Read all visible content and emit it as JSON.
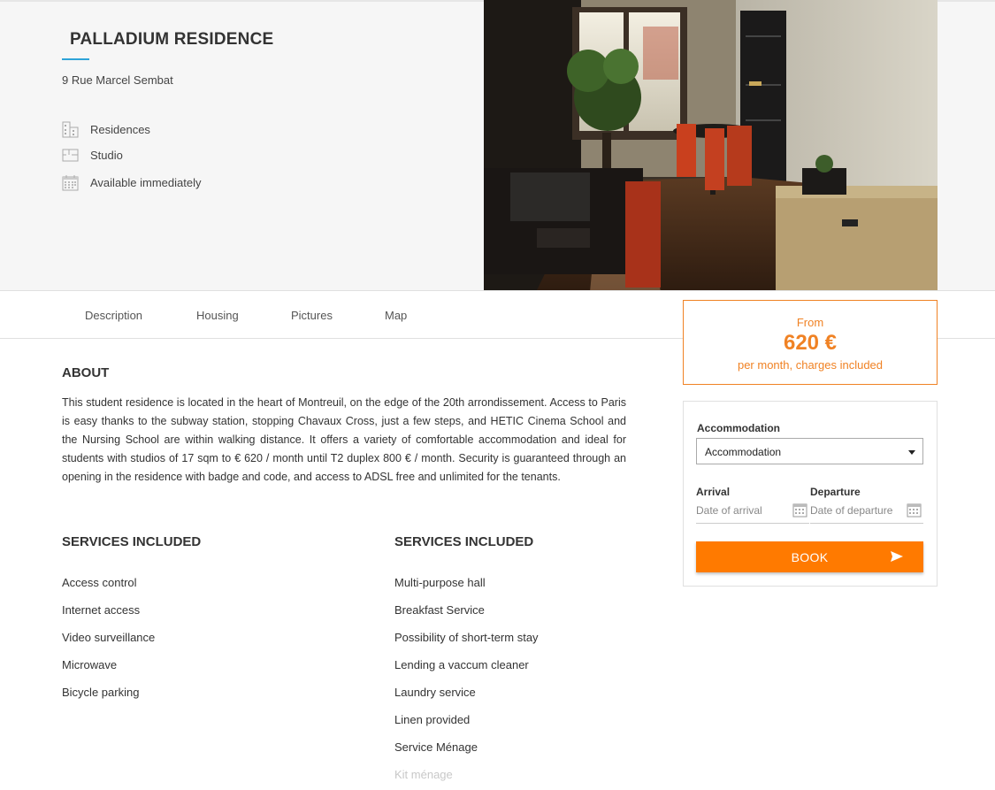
{
  "residence": {
    "title": "PALLADIUM RESIDENCE",
    "address": "9 Rue Marcel Sembat",
    "features": [
      {
        "icon": "building-icon",
        "label": "Residences"
      },
      {
        "icon": "floorplan-icon",
        "label": "Studio"
      },
      {
        "icon": "calendar-icon",
        "label": "Available immediately"
      }
    ]
  },
  "tabs": [
    "Description",
    "Housing",
    "Pictures",
    "Map"
  ],
  "price": {
    "from": "From",
    "amount": "620 €",
    "note": "per month, charges included"
  },
  "booking": {
    "accommodation_label": "Accommodation",
    "accommodation_value": "Accommodation",
    "arrival_label": "Arrival",
    "arrival_placeholder": "Date of arrival",
    "departure_label": "Departure",
    "departure_placeholder": "Date of departure",
    "book_label": "BOOK"
  },
  "about": {
    "heading": "ABOUT",
    "text": "This student residence is located in the heart of Montreuil, on the edge of the 20th arrondissement. Access to Paris is easy thanks to the subway station, stopping Chavaux Cross, just a few steps, and HETIC Cinema School and the Nursing School are within walking distance. It offers a variety of comfortable accommodation and ideal for students with studios of 17 sqm to € 620 / month until T2 duplex 800 € / month. Security is guaranteed through an opening in the residence with badge and code, and access to ADSL free and unlimited for the tenants."
  },
  "services_left": {
    "heading": "SERVICES INCLUDED",
    "items": [
      "Access control",
      "Internet access",
      "Video surveillance",
      "Microwave",
      "Bicycle parking"
    ]
  },
  "services_right": {
    "heading": "SERVICES INCLUDED",
    "items": [
      "Multi-purpose hall",
      "Breakfast Service",
      "Possibility of short-term stay",
      "Lending a vaccum cleaner",
      "Laundry service",
      "Linen provided",
      "Service Ménage",
      "Kit ménage"
    ]
  },
  "colors": {
    "accent_orange": "#f08224",
    "button_orange": "#ff7a00",
    "title_underline": "#2ea3d8"
  }
}
